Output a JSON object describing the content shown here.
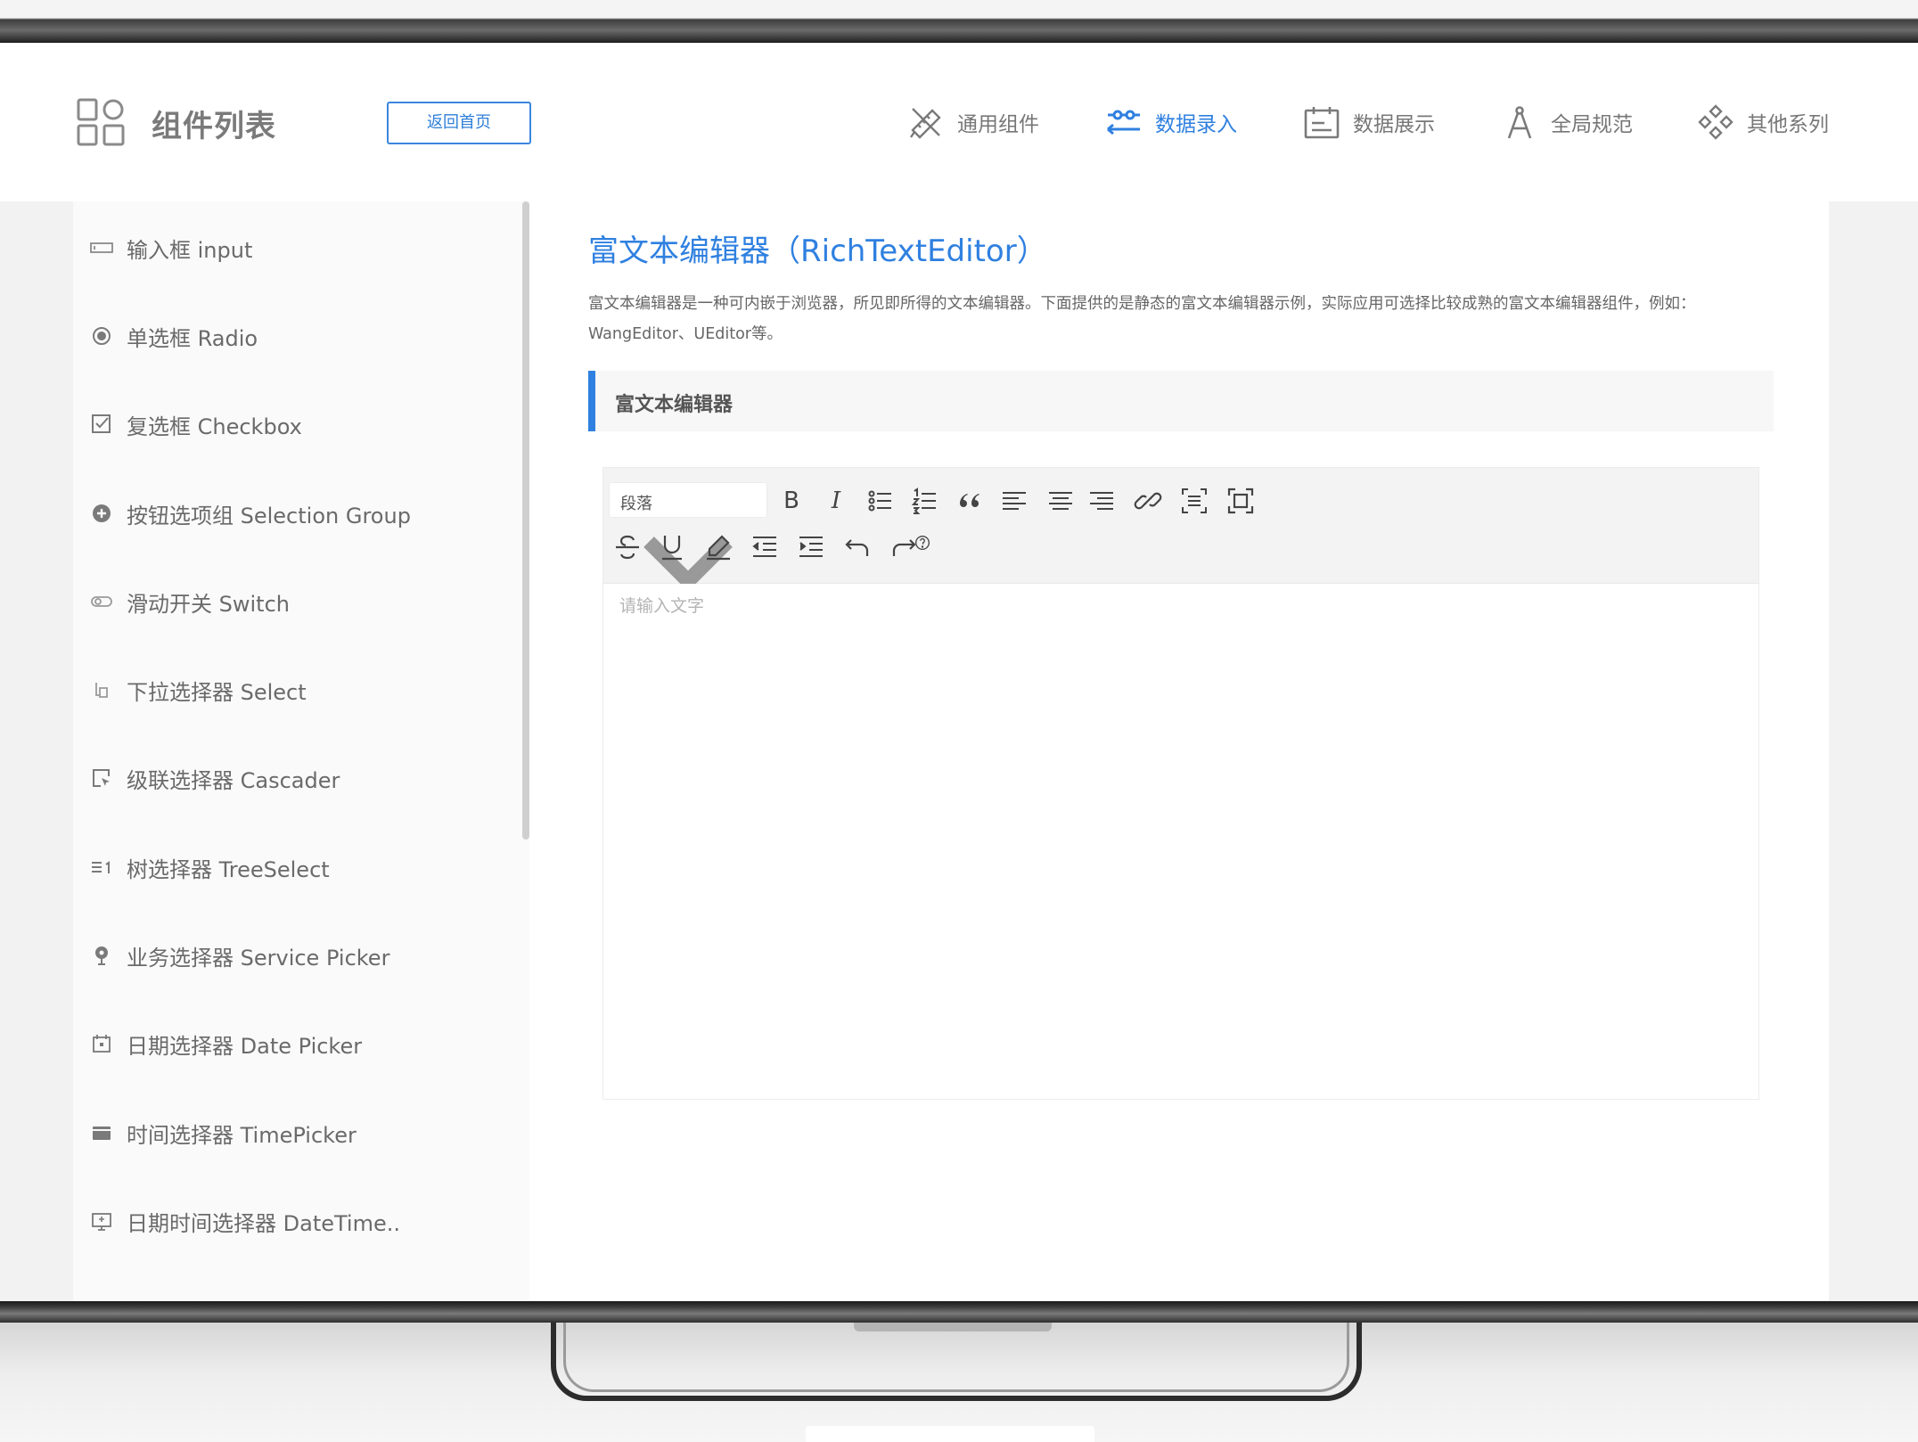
{
  "header": {
    "brand_title": "组件列表",
    "home_button": "返回首页",
    "nav": [
      {
        "label": "通用组件",
        "icon": "ruler-pencil-icon",
        "active": false
      },
      {
        "label": "数据录入",
        "icon": "sliders-icon",
        "active": true
      },
      {
        "label": "数据展示",
        "icon": "calendar-board-icon",
        "active": false
      },
      {
        "label": "全局规范",
        "icon": "compass-icon",
        "active": false
      },
      {
        "label": "其他系列",
        "icon": "diamond-grid-icon",
        "active": false
      }
    ]
  },
  "sidebar": {
    "items": [
      {
        "label": "输入框 input",
        "icon": "input-box-icon"
      },
      {
        "label": "单选框 Radio",
        "icon": "radio-icon"
      },
      {
        "label": "复选框 Checkbox",
        "icon": "checkbox-icon"
      },
      {
        "label": "按钮选项组 Selection Group",
        "icon": "plus-circle-icon"
      },
      {
        "label": "滑动开关 Switch",
        "icon": "toggle-icon"
      },
      {
        "label": "下拉选择器 Select",
        "icon": "pointer-icon"
      },
      {
        "label": "级联选择器 Cascader",
        "icon": "cascader-icon"
      },
      {
        "label": "树选择器 TreeSelect",
        "icon": "tree-icon"
      },
      {
        "label": "业务选择器 Service Picker",
        "icon": "pin-icon"
      },
      {
        "label": "日期选择器 Date Picker",
        "icon": "calendar-icon"
      },
      {
        "label": "时间选择器 TimePicker",
        "icon": "card-icon"
      },
      {
        "label": "日期时间选择器 DateTime..",
        "icon": "monitor-icon"
      }
    ]
  },
  "main": {
    "title": "富文本编辑器（RichTextEditor）",
    "description": "富文本编辑器是一种可内嵌于浏览器，所见即所得的文本编辑器。下面提供的是静态的富文本编辑器示例，实际应用可选择比较成熟的富文本编辑器组件，例如：WangEditor、UEditor等。",
    "section_title": "富文本编辑器",
    "editor": {
      "paragraph_select": "段落",
      "bold": "B",
      "italic": "I",
      "placeholder": "请输入文字",
      "toolbar_row1": [
        "bold-icon",
        "italic-icon",
        "bullet-list-icon",
        "numbered-list-icon",
        "quote-icon",
        "align-left-icon",
        "align-center-icon",
        "align-right-icon",
        "link-icon",
        "insert-icon",
        "fullscreen-icon"
      ],
      "toolbar_row2": [
        "strikethrough-icon",
        "underline-icon",
        "eraser-icon",
        "outdent-icon",
        "indent-icon",
        "undo-icon",
        "redo-icon",
        "help-icon"
      ]
    }
  },
  "colors": {
    "accent": "#2f80e0",
    "text_muted": "#777777",
    "sidebar_bg": "#fafafa"
  }
}
